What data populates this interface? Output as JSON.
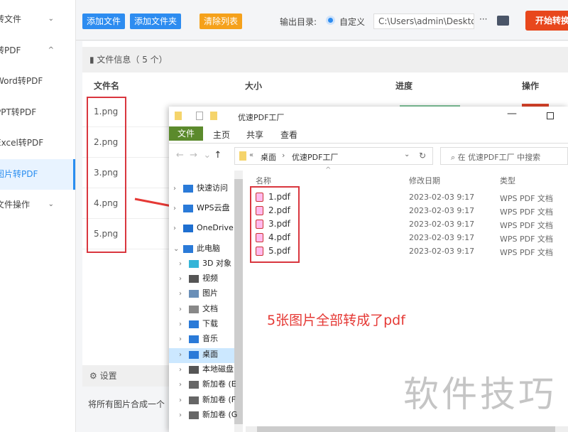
{
  "sidebar": {
    "items": [
      {
        "label": "转文件",
        "chev": "⌄"
      },
      {
        "label": "转PDF",
        "chev": "^"
      },
      {
        "label": "Word转PDF"
      },
      {
        "label": "PPT转PDF"
      },
      {
        "label": "Excel转PDF"
      },
      {
        "label": "图片转PDF",
        "active": true
      },
      {
        "label": "文件操作",
        "chev": "⌄"
      }
    ]
  },
  "toolbar": {
    "add_file": "添加文件",
    "add_folder": "添加文件夹",
    "clear_list": "清除列表",
    "output_label": "输出目录:",
    "radio_label": "自定义",
    "output_path": "C:\\Users\\admin\\Deskto",
    "more": "···",
    "start": "开始转换"
  },
  "file_info": {
    "title": "文件信息（ 5 个）",
    "columns": [
      "文件名",
      "大小",
      "进度",
      "操作"
    ],
    "rows": [
      "1.png",
      "2.png",
      "3.png",
      "4.png",
      "5.png"
    ]
  },
  "settings": {
    "title": "设置",
    "merge_option": "将所有图片合成一个"
  },
  "explorer": {
    "title": "优速PDF工厂",
    "ribbon": [
      "文件",
      "主页",
      "共享",
      "查看"
    ],
    "breadcrumb": [
      "«",
      "桌面",
      "›",
      "优速PDF工厂"
    ],
    "search_placeholder": "在 优速PDF工厂 中搜索",
    "nav": [
      "快速访问",
      "WPS云盘",
      "OneDrive",
      "此电脑",
      "3D 对象",
      "视频",
      "图片",
      "文档",
      "下载",
      "音乐",
      "桌面",
      "本地磁盘",
      "新加卷 (E",
      "新加卷 (F",
      "新加卷 (G"
    ],
    "columns": [
      "名称",
      "修改日期",
      "类型"
    ],
    "files": [
      {
        "name": "1.pdf",
        "date": "2023-02-03 9:17",
        "type": "WPS PDF 文档"
      },
      {
        "name": "2.pdf",
        "date": "2023-02-03 9:17",
        "type": "WPS PDF 文档"
      },
      {
        "name": "3.pdf",
        "date": "2023-02-03 9:17",
        "type": "WPS PDF 文档"
      },
      {
        "name": "4.pdf",
        "date": "2023-02-03 9:17",
        "type": "WPS PDF 文档"
      },
      {
        "name": "5.pdf",
        "date": "2023-02-03 9:17",
        "type": "WPS PDF 文档"
      }
    ]
  },
  "annotation": "5张图片全部转成了pdf",
  "watermark": "软件技巧"
}
